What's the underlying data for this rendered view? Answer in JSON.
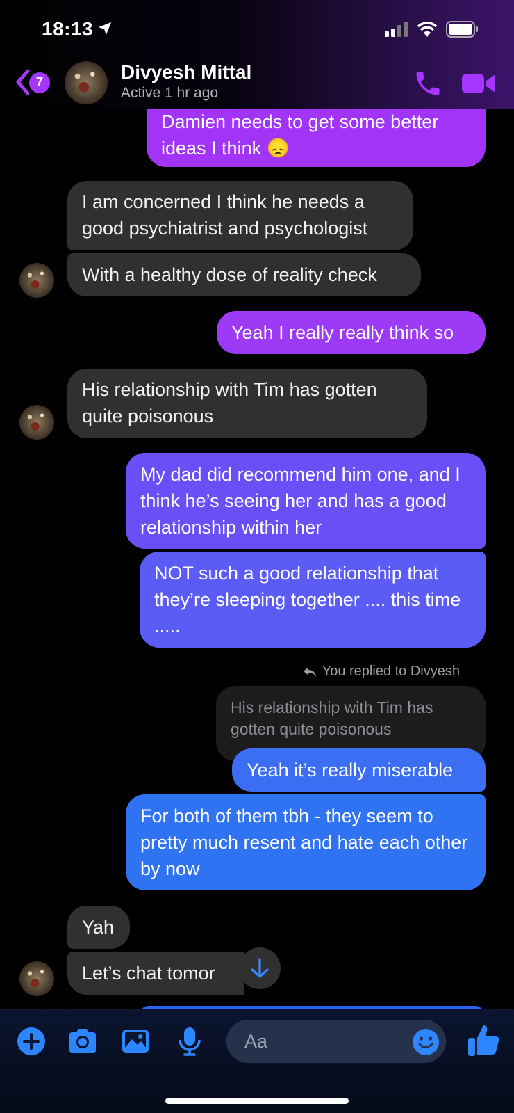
{
  "status_bar": {
    "time": "18:13"
  },
  "header": {
    "back_badge": "7",
    "name": "Divyesh Mittal",
    "status": "Active 1 hr ago"
  },
  "messages": [
    {
      "from": "me",
      "text": "Damien needs to get some better ideas I think 😞"
    },
    {
      "from": "them",
      "text": "I am concerned I think he needs a good psychiatrist and psychologist"
    },
    {
      "from": "them",
      "text": "With a healthy dose of reality check"
    },
    {
      "from": "me",
      "text": "Yeah I really really think so"
    },
    {
      "from": "them",
      "text": "His relationship with Tim has gotten quite poisonous"
    },
    {
      "from": "me",
      "text": "My dad did recommend him one, and I think he’s seeing her and has a good relationship within her"
    },
    {
      "from": "me",
      "text": "NOT such a good relationship that they’re sleeping together .... this time ....."
    },
    {
      "from": "me",
      "text": "Yeah it’s really miserable"
    },
    {
      "from": "me",
      "text": "For both of them tbh - they seem to pretty much resent and hate each other by now"
    },
    {
      "from": "them",
      "text": "Yah"
    },
    {
      "from": "them",
      "text": "Let’s chat tomor"
    }
  ],
  "reply": {
    "note": "You replied to Divyesh",
    "quoted_text": "His relationship with Tim has gotten quite poisonous"
  },
  "composer": {
    "placeholder": "Aa"
  },
  "colors": {
    "accent_purple": "#a436ff",
    "sent_top": "#a234f7",
    "sent_mid": "#5f55f5",
    "sent_bottom": "#2f6ff2",
    "received": "#303030",
    "composer_icon": "#2e86ff"
  },
  "icons": [
    "location-arrow-icon",
    "signal-icon",
    "wifi-icon",
    "battery-icon",
    "back-chevron-icon",
    "phone-icon",
    "video-icon",
    "reply-arrow-icon",
    "arrow-down-icon",
    "plus-icon",
    "camera-icon",
    "photo-icon",
    "microphone-icon",
    "emoji-icon",
    "thumbs-up-icon"
  ]
}
